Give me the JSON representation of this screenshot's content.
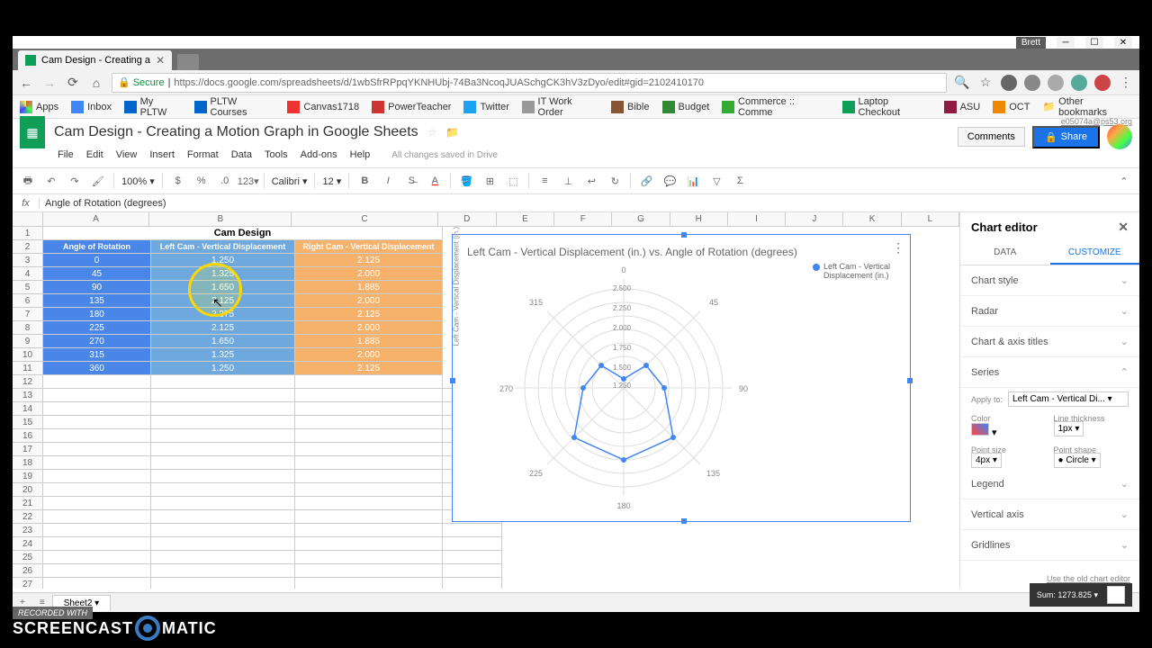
{
  "window": {
    "user": "Brett"
  },
  "browser": {
    "tab_title": "Cam Design - Creating a",
    "secure_label": "Secure",
    "url": "https://docs.google.com/spreadsheets/d/1wbSfrRPpqYKNHUbj-74Ba3NcoqJUASchgCK3hV3zDyo/edit#gid=2102410170"
  },
  "bookmarks": [
    "Apps",
    "Inbox",
    "My PLTW",
    "PLTW Courses",
    "Canvas1718",
    "PowerTeacher",
    "Twitter",
    "IT Work Order",
    "Bible",
    "Budget",
    "Commerce :: Comme",
    "Laptop Checkout",
    "ASU",
    "OCT"
  ],
  "other_bookmarks": "Other bookmarks",
  "doc": {
    "title": "Cam Design - Creating a Motion Graph in Google Sheets",
    "email": "e05074a@ps53.org",
    "comments": "Comments",
    "share": "Share",
    "menus": [
      "File",
      "Edit",
      "View",
      "Insert",
      "Format",
      "Data",
      "Tools",
      "Add-ons",
      "Help"
    ],
    "saved": "All changes saved in Drive",
    "zoom": "100%",
    "font": "Calibri",
    "size": "12",
    "formula": "Angle of Rotation (degrees)"
  },
  "columns": [
    "A",
    "B",
    "C",
    "D",
    "E",
    "F",
    "G",
    "H",
    "I",
    "J",
    "K",
    "L"
  ],
  "table": {
    "title": "Cam Design",
    "headers": [
      "Angle of Rotation (degrees)",
      "Left Cam - Vertical Displacement (in.)",
      "Right Cam - Vertical Displacement (in.)"
    ],
    "rows": [
      {
        "a": "0",
        "b": "1.250",
        "c": "2.125"
      },
      {
        "a": "45",
        "b": "1.325",
        "c": "2.000"
      },
      {
        "a": "90",
        "b": "1.650",
        "c": "1.885"
      },
      {
        "a": "135",
        "b": "2.125",
        "c": "2.000"
      },
      {
        "a": "180",
        "b": "2.375",
        "c": "2.125"
      },
      {
        "a": "225",
        "b": "2.125",
        "c": "2.000"
      },
      {
        "a": "270",
        "b": "1.650",
        "c": "1.885"
      },
      {
        "a": "315",
        "b": "1.325",
        "c": "2.000"
      },
      {
        "a": "360",
        "b": "1.250",
        "c": "2.125"
      }
    ]
  },
  "chart": {
    "title": "Left Cam - Vertical Displacement (in.) vs. Angle of Rotation (degrees)",
    "legend": "Left Cam - Vertical Displacement (in.)",
    "ylabel": "Left Cam - Vertical Displacement (in.)",
    "ticks": [
      "0",
      "2.500",
      "2.250",
      "2.000",
      "1.750",
      "1.500",
      "1.250"
    ],
    "angles": [
      "0",
      "45",
      "90",
      "135",
      "180",
      "225",
      "270",
      "315"
    ]
  },
  "chart_data": {
    "type": "radar",
    "categories": [
      0,
      45,
      90,
      135,
      180,
      225,
      270,
      315,
      360
    ],
    "series": [
      {
        "name": "Left Cam - Vertical Displacement (in.)",
        "values": [
          1.25,
          1.325,
          1.65,
          2.125,
          2.375,
          2.125,
          1.65,
          1.325,
          1.25
        ]
      },
      {
        "name": "Right Cam - Vertical Displacement (in.)",
        "values": [
          2.125,
          2.0,
          1.885,
          2.0,
          2.125,
          2.0,
          1.885,
          2.0,
          2.125
        ]
      }
    ],
    "title": "Left Cam - Vertical Displacement (in.) vs. Angle of Rotation (degrees)",
    "ylim": [
      0,
      2.5
    ]
  },
  "editor": {
    "title": "Chart editor",
    "tabs": [
      "DATA",
      "CUSTOMIZE"
    ],
    "sections": [
      "Chart style",
      "Radar",
      "Chart & axis titles",
      "Series",
      "Legend",
      "Vertical axis",
      "Gridlines"
    ],
    "apply_to_label": "Apply to:",
    "apply_to": "Left Cam - Vertical Di...",
    "color_label": "Color",
    "line_thickness_label": "Line thickness",
    "line_thickness": "1px",
    "point_size_label": "Point size",
    "point_size": "4px",
    "point_shape_label": "Point shape",
    "point_shape": "Circle",
    "old_link": "Use the old chart editor"
  },
  "sheet_tab": "Sheet2",
  "status": {
    "sum_label": "Sum:",
    "sum": "1273.825"
  },
  "watermark": {
    "recorded": "RECORDED WITH",
    "brand1": "SCREENCAST",
    "brand2": "MATIC"
  }
}
